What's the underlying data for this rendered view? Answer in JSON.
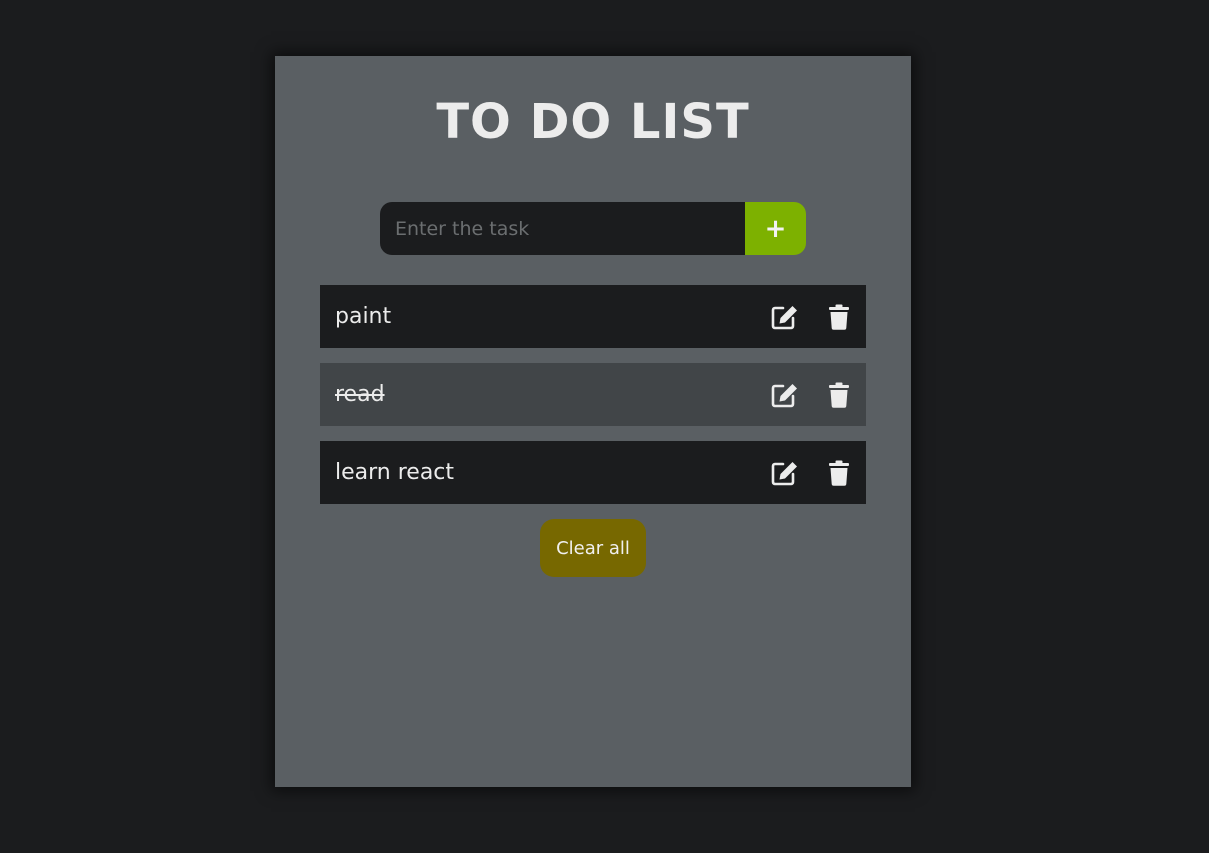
{
  "app": {
    "title": "TO DO LIST"
  },
  "input": {
    "placeholder": "Enter the task",
    "value": "",
    "add_label": "+"
  },
  "tasks": [
    {
      "text": "paint",
      "completed": false
    },
    {
      "text": "read",
      "completed": true
    },
    {
      "text": "learn react",
      "completed": false
    }
  ],
  "icons": {
    "edit": "edit-icon",
    "delete": "trash-icon"
  },
  "clear_button": {
    "label": "Clear all"
  },
  "colors": {
    "background": "#1b1c1e",
    "card": "#5a5f63",
    "add_button": "#7db100",
    "clear_button": "#776800",
    "task_item": "#1b1c1e",
    "task_item_completed": "#414548",
    "text": "#ececec"
  }
}
